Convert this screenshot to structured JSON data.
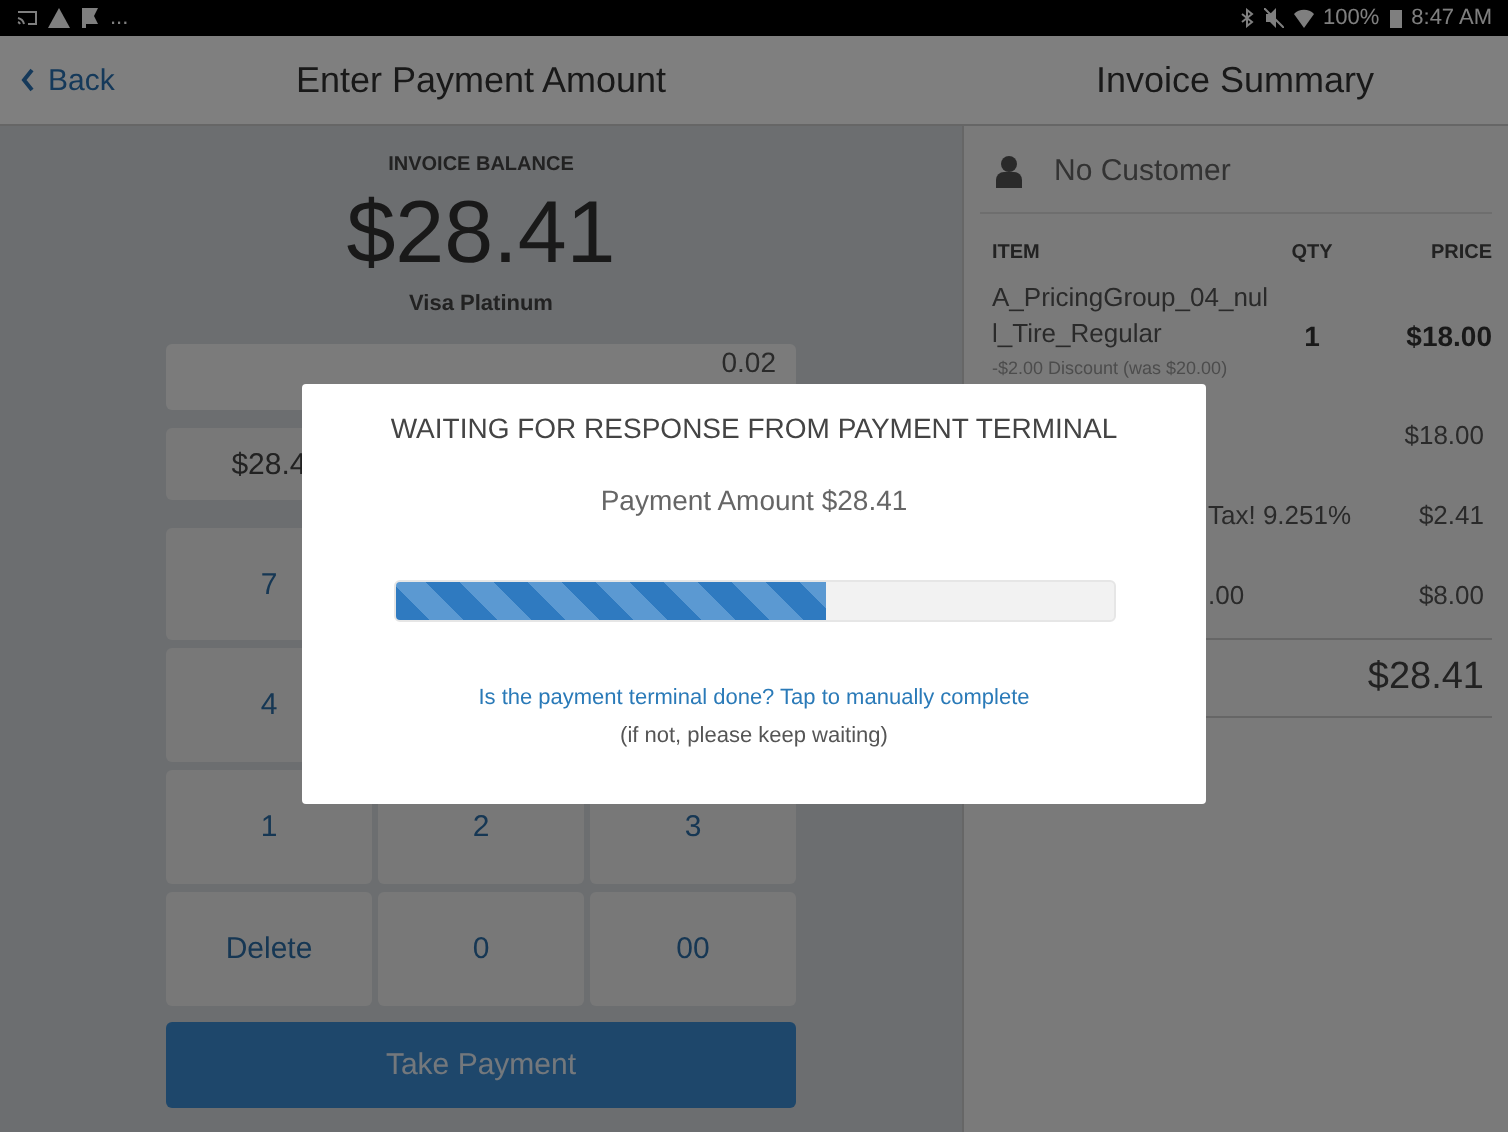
{
  "status_bar": {
    "more": "...",
    "battery": "100%",
    "time": "8:47 AM"
  },
  "header": {
    "back": "Back",
    "title": "Enter Payment Amount",
    "summary_title": "Invoice Summary"
  },
  "payment": {
    "balance_label": "INVOICE BALANCE",
    "balance": "$28.41",
    "card": "Visa Platinum",
    "amount_value": "0.02",
    "quick_amount": "$28.4",
    "keys": [
      {
        "label": "7"
      },
      {
        "label": "4"
      },
      {
        "label": "1"
      },
      {
        "label": "2"
      },
      {
        "label": "3"
      },
      {
        "label": "Delete"
      },
      {
        "label": "0"
      },
      {
        "label": "00"
      }
    ],
    "submit": "Take Payment"
  },
  "invoice": {
    "customer": "No Customer",
    "columns": [
      "ITEM",
      "QTY",
      "PRICE"
    ],
    "items": [
      {
        "name": "A_PricingGroup_04_null_Tire_Regular",
        "qty": "1",
        "price": "$18.00",
        "note": "-$2.00 Discount (was $20.00)"
      }
    ],
    "summary_rows": [
      {
        "label": "",
        "value": "$18.00"
      },
      {
        "label": "Tax! 9.251%",
        "value": "$2.41"
      },
      {
        "label": ".00",
        "value": "$8.00"
      }
    ],
    "total": "$28.41"
  },
  "dialog": {
    "title": "WAITING FOR RESPONSE FROM PAYMENT TERMINAL",
    "amount": "Payment Amount $28.41",
    "level": 0.6,
    "link": "Is the payment terminal done? Tap to manually complete",
    "note": "(if not, please keep waiting)"
  }
}
